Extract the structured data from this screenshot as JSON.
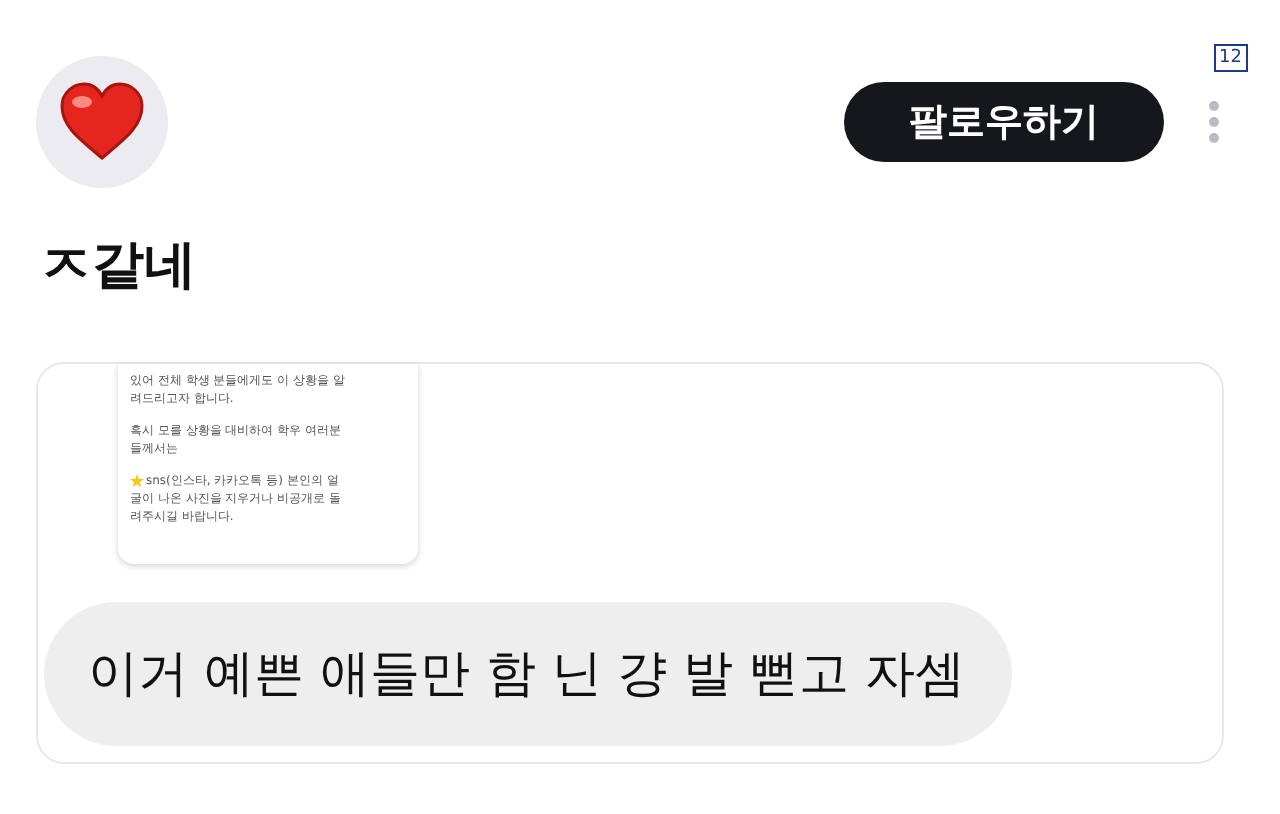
{
  "badge": "12",
  "follow_button": "팔로우하기",
  "post_title": "ㅈ같네",
  "attached_message": {
    "paragraphs": [
      [
        "있어 전체 학생 분들에게도 이 상황을 알",
        "려드리고자 합니다."
      ],
      [
        "혹시 모를 상황을 대비하여 학우 여러분",
        "들께서는"
      ],
      [
        "sns(인스타, 카카오톡 등) 본인의 얼",
        "굴이 나온 사진을 지우거나 비공개로 돌",
        "려주시길 바랍니다."
      ]
    ]
  },
  "comment_bubble": "이거 예쁜 애들만 함 닌 걍 발 뻗고 자셈"
}
